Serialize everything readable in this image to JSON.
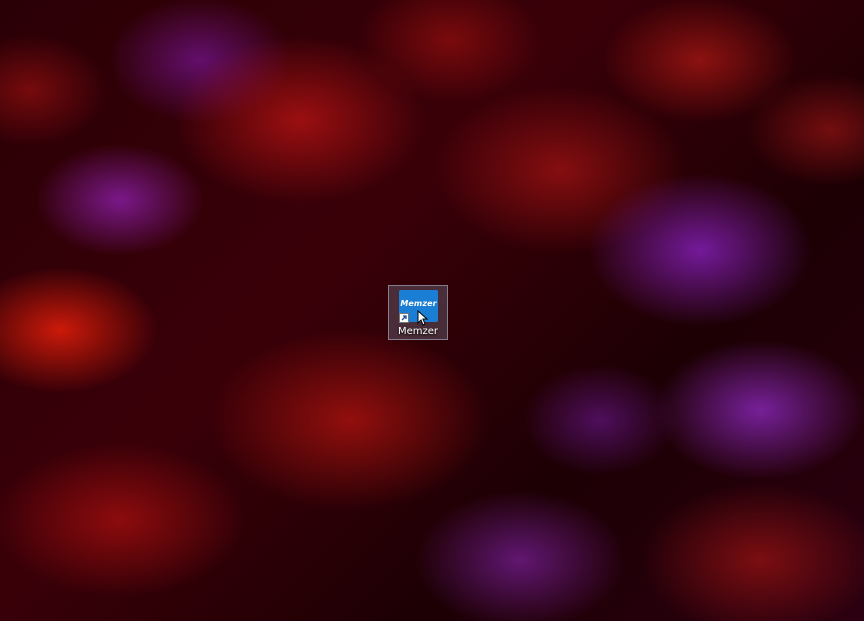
{
  "desktop": {
    "icons": [
      {
        "label": "Memzer",
        "tile_text": "Memzer",
        "tile_color": "#1a7fd4",
        "has_shortcut_arrow": true,
        "selected": true
      }
    ],
    "wallpaper": {
      "style": "abstract red and purple fluid pattern",
      "colors": [
        "#c01010",
        "#8a1fb0",
        "#1a0003"
      ]
    }
  },
  "cursor": {
    "icon": "arrow-pointer-icon"
  }
}
